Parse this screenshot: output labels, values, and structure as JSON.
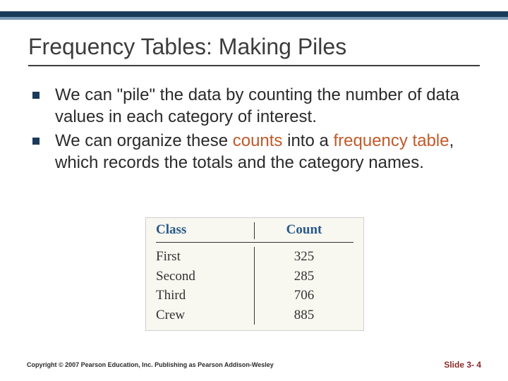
{
  "title": "Frequency Tables: Making Piles",
  "bullets": [
    {
      "pre": "We can \"pile\" the data by counting the number of data values in each category of interest.",
      "hi1": "",
      "mid": "",
      "hi2": "",
      "post": ""
    },
    {
      "pre": "We can organize these ",
      "hi1": "counts",
      "mid": " into a ",
      "hi2": "frequency table",
      "post": ", which records the totals and the category names."
    }
  ],
  "table": {
    "headers": {
      "class": "Class",
      "count": "Count"
    },
    "rows": [
      {
        "class": "First",
        "count": "325"
      },
      {
        "class": "Second",
        "count": "285"
      },
      {
        "class": "Third",
        "count": "706"
      },
      {
        "class": "Crew",
        "count": "885"
      }
    ]
  },
  "footer": {
    "copyright": "Copyright © 2007 Pearson Education, Inc. Publishing as Pearson Addison-Wesley",
    "slide": "Slide 3- 4"
  },
  "chart_data": {
    "type": "table",
    "title": "Frequency Tables: Making Piles",
    "columns": [
      "Class",
      "Count"
    ],
    "rows": [
      [
        "First",
        325
      ],
      [
        "Second",
        285
      ],
      [
        "Third",
        706
      ],
      [
        "Crew",
        885
      ]
    ]
  }
}
